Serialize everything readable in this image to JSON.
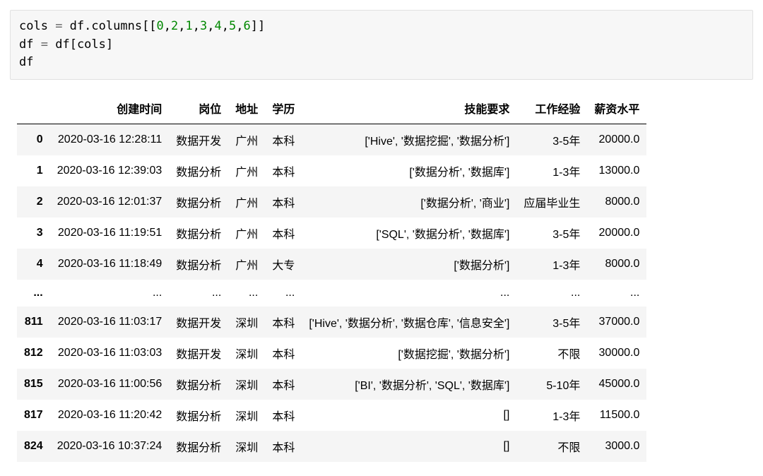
{
  "code": {
    "line1": {
      "t1": "cols ",
      "eq": "=",
      "t2": " df",
      "dot1": ".",
      "t3": "columns",
      "lb": "[[",
      "nums": [
        "0",
        "2",
        "1",
        "3",
        "4",
        "5",
        "6"
      ],
      "comma": ",",
      "rb": "]]"
    },
    "line2": {
      "t1": "df ",
      "eq": "=",
      "t2": " df",
      "lb": "[",
      "t3": "cols",
      "rb": "]"
    },
    "line3": {
      "t1": "df"
    }
  },
  "table": {
    "columns": [
      "创建时间",
      "岗位",
      "地址",
      "学历",
      "技能要求",
      "工作经验",
      "薪资水平"
    ],
    "ellipsis_label": "...",
    "rows": [
      {
        "idx": "0",
        "created": "2020-03-16 12:28:11",
        "position": "数据开发",
        "city": "广州",
        "edu": "本科",
        "skills": "['Hive', '数据挖掘', '数据分析']",
        "exp": "3-5年",
        "salary": "20000.0"
      },
      {
        "idx": "1",
        "created": "2020-03-16 12:39:03",
        "position": "数据分析",
        "city": "广州",
        "edu": "本科",
        "skills": "['数据分析', '数据库']",
        "exp": "1-3年",
        "salary": "13000.0"
      },
      {
        "idx": "2",
        "created": "2020-03-16 12:01:37",
        "position": "数据分析",
        "city": "广州",
        "edu": "本科",
        "skills": "['数据分析', '商业']",
        "exp": "应届毕业生",
        "salary": "8000.0"
      },
      {
        "idx": "3",
        "created": "2020-03-16 11:19:51",
        "position": "数据分析",
        "city": "广州",
        "edu": "本科",
        "skills": "['SQL', '数据分析', '数据库']",
        "exp": "3-5年",
        "salary": "20000.0"
      },
      {
        "idx": "4",
        "created": "2020-03-16 11:18:49",
        "position": "数据分析",
        "city": "广州",
        "edu": "大专",
        "skills": "['数据分析']",
        "exp": "1-3年",
        "salary": "8000.0"
      },
      {
        "ellipsis": true
      },
      {
        "idx": "811",
        "created": "2020-03-16 11:03:17",
        "position": "数据开发",
        "city": "深圳",
        "edu": "本科",
        "skills": "['Hive', '数据分析', '数据仓库', '信息安全']",
        "exp": "3-5年",
        "salary": "37000.0"
      },
      {
        "idx": "812",
        "created": "2020-03-16 11:03:03",
        "position": "数据开发",
        "city": "深圳",
        "edu": "本科",
        "skills": "['数据挖掘', '数据分析']",
        "exp": "不限",
        "salary": "30000.0"
      },
      {
        "idx": "815",
        "created": "2020-03-16 11:00:56",
        "position": "数据分析",
        "city": "深圳",
        "edu": "本科",
        "skills": "['BI', '数据分析', 'SQL', '数据库']",
        "exp": "5-10年",
        "salary": "45000.0"
      },
      {
        "idx": "817",
        "created": "2020-03-16 11:20:42",
        "position": "数据分析",
        "city": "深圳",
        "edu": "本科",
        "skills": "[]",
        "exp": "1-3年",
        "salary": "11500.0"
      },
      {
        "idx": "824",
        "created": "2020-03-16 10:37:24",
        "position": "数据分析",
        "city": "深圳",
        "edu": "本科",
        "skills": "[]",
        "exp": "不限",
        "salary": "3000.0"
      }
    ]
  }
}
